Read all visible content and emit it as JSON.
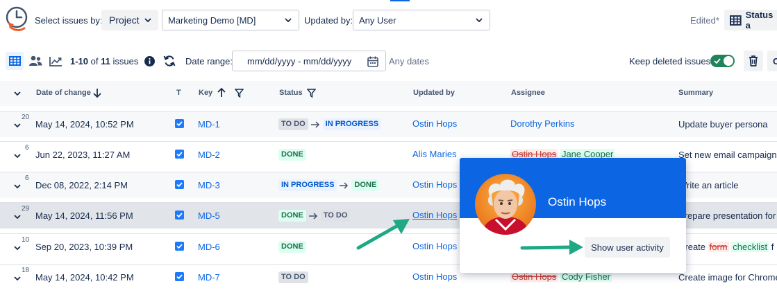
{
  "toolbar": {
    "select_label": "Select issues by:",
    "select_by": "Project",
    "project": "Marketing Demo [MD]",
    "updated_by_label": "Updated by:",
    "updated_by": "Any User",
    "edited": "Edited*",
    "status_button": "Status a"
  },
  "toolbar2": {
    "count_range": "1-10",
    "count_of": " of ",
    "count_total": "11",
    "count_suffix": " issues",
    "date_range_label": "Date range:",
    "date_placeholder": "mm/dd/yyyy - mm/dd/yyyy",
    "any_dates": "Any dates",
    "keep_deleted_label": "Keep deleted issues",
    "keep_deleted": true,
    "trailing_button": "C"
  },
  "columns": {
    "date": "Date of change",
    "type": "T",
    "key": "Key",
    "status": "Status",
    "updated_by": "Updated by",
    "assignee": "Assignee",
    "summary": "Summary"
  },
  "rows": [
    {
      "count": "20",
      "date": "May 14, 2024, 10:52 PM",
      "key": "MD-1",
      "status_from": "TO DO",
      "status_to": "IN PROGRESS",
      "updated_by": "Ostin Hops",
      "assignee": "Dorothy Perkins",
      "summary": "Update buyer persona"
    },
    {
      "count": "6",
      "date": "Jun 22, 2023, 11:27 AM",
      "key": "MD-2",
      "status": "DONE",
      "updated_by": "Alis Maries",
      "assignee_old": "Ostin Hops",
      "assignee_new": "Jane Cooper",
      "summary": "Set new email campaign"
    },
    {
      "count": "6",
      "date": "Dec 08, 2022, 2:14 PM",
      "key": "MD-3",
      "status_from": "IN PROGRESS",
      "status_to": "DONE",
      "updated_by": "Ostin Hops",
      "summary": "Write an article"
    },
    {
      "count": "29",
      "date": "May 14, 2024, 11:56 PM",
      "key": "MD-5",
      "status_from": "DONE",
      "status_to": "TO DO",
      "updated_by": "Ostin Hops",
      "summary": "Prepare presentation for c"
    },
    {
      "count": "10",
      "date": "Sep 20, 2023, 10:39 PM",
      "key": "MD-6",
      "status": "DONE",
      "updated_by": "Ostin Hops",
      "summary_prefix": "Create ",
      "summary_old": "form",
      "summary_new": "checklist",
      "summary_suffix": " f"
    },
    {
      "count": "18",
      "date": "May 14, 2024, 10:42 PM",
      "key": "MD-7",
      "status": "TO DO",
      "updated_by": "Ostin Hops",
      "assignee_old": "Ostin Hops",
      "assignee_new": "Cody Fisher",
      "summary": "Create image for Chrome"
    }
  ],
  "popup": {
    "name": "Ostin Hops",
    "action": "Show user activity"
  },
  "colors": {
    "accent": "#0c66e4",
    "annotation_arrow": "#1fa884",
    "toggle_on": "#1f845a"
  }
}
